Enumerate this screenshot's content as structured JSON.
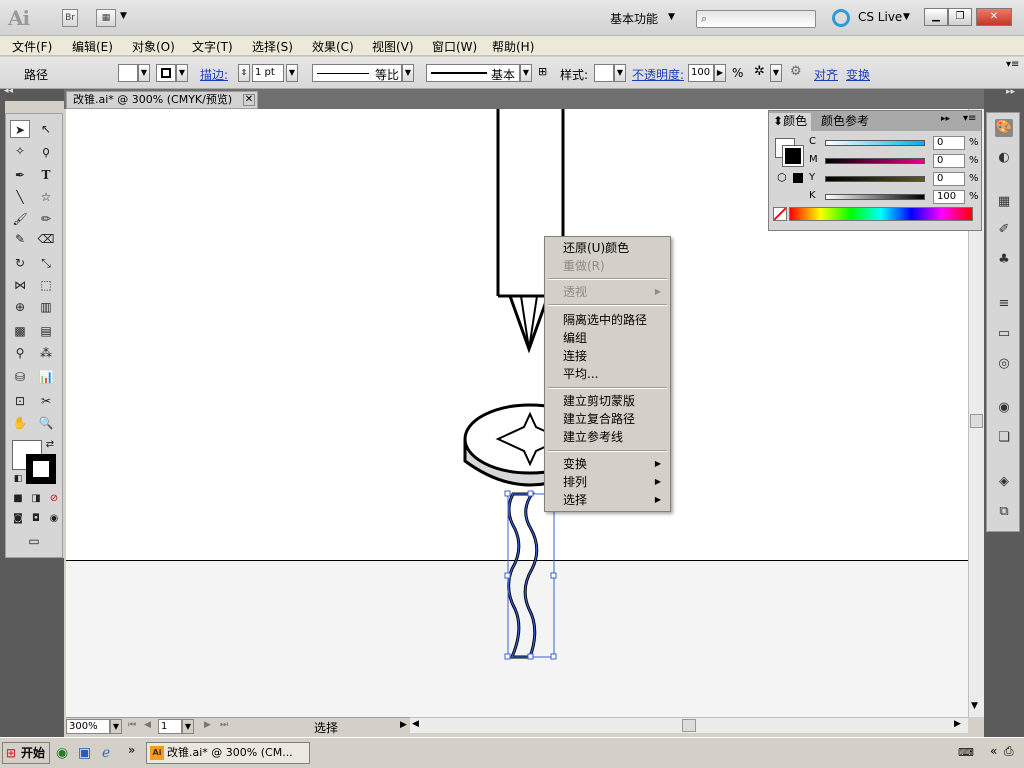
{
  "titlebar": {
    "logo": "Ai",
    "bridge_label": "Br",
    "workspace": "基本功能",
    "cslive": "CS Live",
    "close_glyph": "✕"
  },
  "menubar": {
    "items": [
      "文件(F)",
      "编辑(E)",
      "对象(O)",
      "文字(T)",
      "选择(S)",
      "效果(C)",
      "视图(V)",
      "窗口(W)",
      "帮助(H)"
    ]
  },
  "controlbar": {
    "path_label": "路径",
    "stroke_label": "描边:",
    "stroke_weight": "1 pt",
    "profile_label": "等比",
    "brush_label": "基本",
    "style_label": "样式:",
    "opacity_label": "不透明度:",
    "opacity_value": "100",
    "percent": "%",
    "align_link": "对齐",
    "transform_link": "变换"
  },
  "document": {
    "tab_title": "改锥.ai* @ 300% (CMYK/预览)"
  },
  "statusbar": {
    "zoom": "300%",
    "page": "1",
    "tool": "选择"
  },
  "color_panel": {
    "tab_color": "颜色",
    "tab_guide": "颜色参考",
    "rows": [
      {
        "label": "C",
        "value": "0",
        "color": "#00aeef"
      },
      {
        "label": "M",
        "value": "0",
        "color": "#ec008c"
      },
      {
        "label": "Y",
        "value": "0",
        "color": "#fff200"
      },
      {
        "label": "K",
        "value": "100",
        "color": "#000000"
      }
    ],
    "pct": "%"
  },
  "context_menu": {
    "undo": "还原(U)颜色",
    "redo": "重做(R)",
    "perspective": "透视",
    "isolate": "隔离选中的路径",
    "group": "编组",
    "join": "连接",
    "average": "平均...",
    "clipping_mask": "建立剪切蒙版",
    "compound_path": "建立复合路径",
    "guides": "建立参考线",
    "transform": "变换",
    "arrange": "排列",
    "select": "选择"
  },
  "taskbar": {
    "start": "开始",
    "window_title": "改锥.ai* @ 300% (CM..."
  },
  "colors": {
    "selection": "#3b5fd9",
    "link": "#1c3fb8"
  }
}
